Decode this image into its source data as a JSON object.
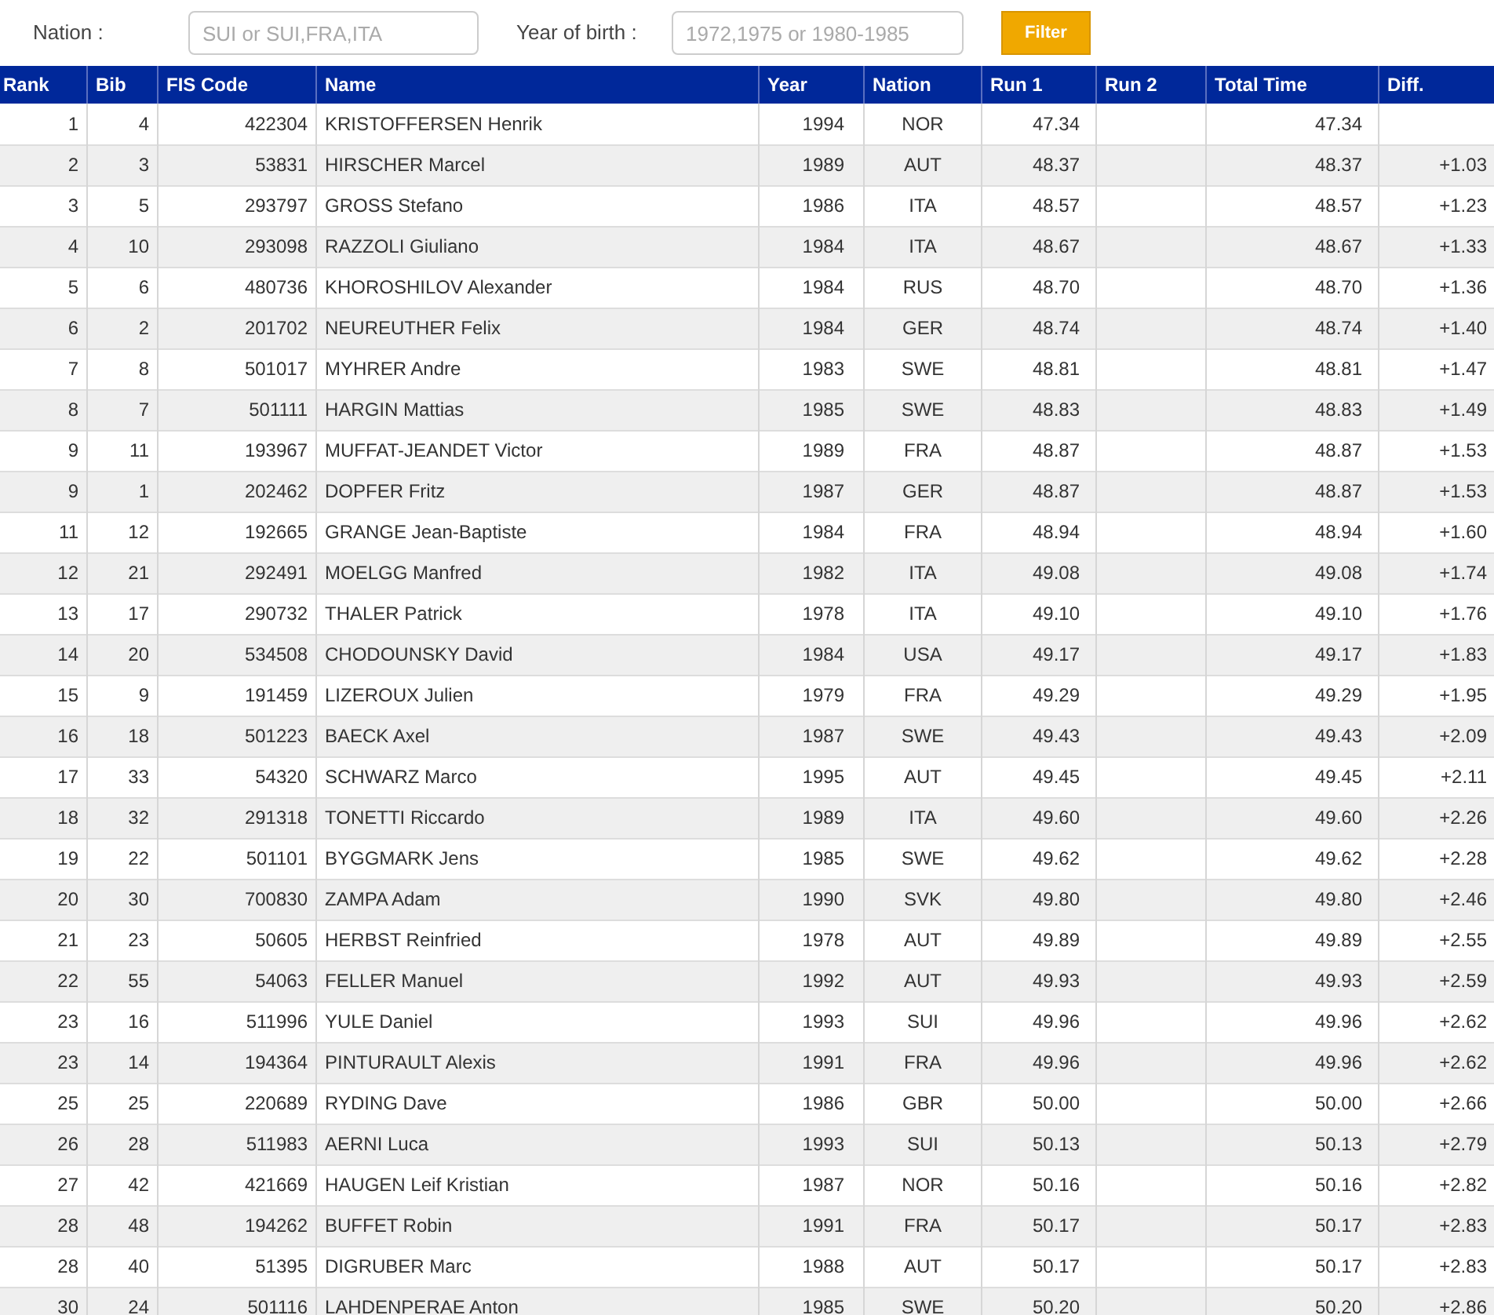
{
  "filter": {
    "nation_label": "Nation :",
    "nation_placeholder": "SUI or SUI,FRA,ITA",
    "year_label": "Year of birth :",
    "year_placeholder": "1972,1975 or 1980-1985",
    "button": "Filter"
  },
  "table": {
    "columns": [
      "Rank",
      "Bib",
      "FIS Code",
      "Name",
      "Year",
      "Nation",
      "Run 1",
      "Run 2",
      "Total Time",
      "Diff."
    ],
    "rows": [
      {
        "rank": "1",
        "bib": "4",
        "fis_code": "422304",
        "name": "KRISTOFFERSEN Henrik",
        "year": "1994",
        "nation": "NOR",
        "run1": "47.34",
        "total": "47.34"
      },
      {
        "rank": "2",
        "bib": "3",
        "fis_code": "53831",
        "name": "HIRSCHER Marcel",
        "year": "1989",
        "nation": "AUT",
        "run1": "48.37",
        "total": "48.37",
        "diff": "+1.03"
      },
      {
        "rank": "3",
        "bib": "5",
        "fis_code": "293797",
        "name": "GROSS Stefano",
        "year": "1986",
        "nation": "ITA",
        "run1": "48.57",
        "total": "48.57",
        "diff": "+1.23"
      },
      {
        "rank": "4",
        "bib": "10",
        "fis_code": "293098",
        "name": "RAZZOLI Giuliano",
        "year": "1984",
        "nation": "ITA",
        "run1": "48.67",
        "total": "48.67",
        "diff": "+1.33"
      },
      {
        "rank": "5",
        "bib": "6",
        "fis_code": "480736",
        "name": "KHOROSHILOV Alexander",
        "year": "1984",
        "nation": "RUS",
        "run1": "48.70",
        "total": "48.70",
        "diff": "+1.36"
      },
      {
        "rank": "6",
        "bib": "2",
        "fis_code": "201702",
        "name": "NEUREUTHER Felix",
        "year": "1984",
        "nation": "GER",
        "run1": "48.74",
        "total": "48.74",
        "diff": "+1.40"
      },
      {
        "rank": "7",
        "bib": "8",
        "fis_code": "501017",
        "name": "MYHRER Andre",
        "year": "1983",
        "nation": "SWE",
        "run1": "48.81",
        "total": "48.81",
        "diff": "+1.47"
      },
      {
        "rank": "8",
        "bib": "7",
        "fis_code": "501111",
        "name": "HARGIN Mattias",
        "year": "1985",
        "nation": "SWE",
        "run1": "48.83",
        "total": "48.83",
        "diff": "+1.49"
      },
      {
        "rank": "9",
        "bib": "11",
        "fis_code": "193967",
        "name": "MUFFAT-JEANDET Victor",
        "year": "1989",
        "nation": "FRA",
        "run1": "48.87",
        "total": "48.87",
        "diff": "+1.53"
      },
      {
        "rank": "9",
        "bib": "1",
        "fis_code": "202462",
        "name": "DOPFER Fritz",
        "year": "1987",
        "nation": "GER",
        "run1": "48.87",
        "total": "48.87",
        "diff": "+1.53"
      },
      {
        "rank": "11",
        "bib": "12",
        "fis_code": "192665",
        "name": "GRANGE Jean-Baptiste",
        "year": "1984",
        "nation": "FRA",
        "run1": "48.94",
        "total": "48.94",
        "diff": "+1.60"
      },
      {
        "rank": "12",
        "bib": "21",
        "fis_code": "292491",
        "name": "MOELGG Manfred",
        "year": "1982",
        "nation": "ITA",
        "run1": "49.08",
        "total": "49.08",
        "diff": "+1.74"
      },
      {
        "rank": "13",
        "bib": "17",
        "fis_code": "290732",
        "name": "THALER Patrick",
        "year": "1978",
        "nation": "ITA",
        "run1": "49.10",
        "total": "49.10",
        "diff": "+1.76"
      },
      {
        "rank": "14",
        "bib": "20",
        "fis_code": "534508",
        "name": "CHODOUNSKY David",
        "year": "1984",
        "nation": "USA",
        "run1": "49.17",
        "total": "49.17",
        "diff": "+1.83"
      },
      {
        "rank": "15",
        "bib": "9",
        "fis_code": "191459",
        "name": "LIZEROUX Julien",
        "year": "1979",
        "nation": "FRA",
        "run1": "49.29",
        "total": "49.29",
        "diff": "+1.95"
      },
      {
        "rank": "16",
        "bib": "18",
        "fis_code": "501223",
        "name": "BAECK Axel",
        "year": "1987",
        "nation": "SWE",
        "run1": "49.43",
        "total": "49.43",
        "diff": "+2.09"
      },
      {
        "rank": "17",
        "bib": "33",
        "fis_code": "54320",
        "name": "SCHWARZ Marco",
        "year": "1995",
        "nation": "AUT",
        "run1": "49.45",
        "total": "49.45",
        "diff": "+2.11"
      },
      {
        "rank": "18",
        "bib": "32",
        "fis_code": "291318",
        "name": "TONETTI Riccardo",
        "year": "1989",
        "nation": "ITA",
        "run1": "49.60",
        "total": "49.60",
        "diff": "+2.26"
      },
      {
        "rank": "19",
        "bib": "22",
        "fis_code": "501101",
        "name": "BYGGMARK Jens",
        "year": "1985",
        "nation": "SWE",
        "run1": "49.62",
        "total": "49.62",
        "diff": "+2.28"
      },
      {
        "rank": "20",
        "bib": "30",
        "fis_code": "700830",
        "name": "ZAMPA Adam",
        "year": "1990",
        "nation": "SVK",
        "run1": "49.80",
        "total": "49.80",
        "diff": "+2.46"
      },
      {
        "rank": "21",
        "bib": "23",
        "fis_code": "50605",
        "name": "HERBST Reinfried",
        "year": "1978",
        "nation": "AUT",
        "run1": "49.89",
        "total": "49.89",
        "diff": "+2.55"
      },
      {
        "rank": "22",
        "bib": "55",
        "fis_code": "54063",
        "name": "FELLER Manuel",
        "year": "1992",
        "nation": "AUT",
        "run1": "49.93",
        "total": "49.93",
        "diff": "+2.59"
      },
      {
        "rank": "23",
        "bib": "16",
        "fis_code": "511996",
        "name": "YULE Daniel",
        "year": "1993",
        "nation": "SUI",
        "run1": "49.96",
        "total": "49.96",
        "diff": "+2.62"
      },
      {
        "rank": "23",
        "bib": "14",
        "fis_code": "194364",
        "name": "PINTURAULT Alexis",
        "year": "1991",
        "nation": "FRA",
        "run1": "49.96",
        "total": "49.96",
        "diff": "+2.62"
      },
      {
        "rank": "25",
        "bib": "25",
        "fis_code": "220689",
        "name": "RYDING Dave",
        "year": "1986",
        "nation": "GBR",
        "run1": "50.00",
        "total": "50.00",
        "diff": "+2.66"
      },
      {
        "rank": "26",
        "bib": "28",
        "fis_code": "511983",
        "name": "AERNI Luca",
        "year": "1993",
        "nation": "SUI",
        "run1": "50.13",
        "total": "50.13",
        "diff": "+2.79"
      },
      {
        "rank": "27",
        "bib": "42",
        "fis_code": "421669",
        "name": "HAUGEN Leif Kristian",
        "year": "1987",
        "nation": "NOR",
        "run1": "50.16",
        "total": "50.16",
        "diff": "+2.82"
      },
      {
        "rank": "28",
        "bib": "48",
        "fis_code": "194262",
        "name": "BUFFET Robin",
        "year": "1991",
        "nation": "FRA",
        "run1": "50.17",
        "total": "50.17",
        "diff": "+2.83"
      },
      {
        "rank": "28",
        "bib": "40",
        "fis_code": "51395",
        "name": "DIGRUBER Marc",
        "year": "1988",
        "nation": "AUT",
        "run1": "50.17",
        "total": "50.17",
        "diff": "+2.83"
      },
      {
        "rank": "30",
        "bib": "24",
        "fis_code": "501116",
        "name": "LAHDENPERAE Anton",
        "year": "1985",
        "nation": "SWE",
        "run1": "50.20",
        "total": "50.20",
        "diff": "+2.86"
      }
    ]
  }
}
